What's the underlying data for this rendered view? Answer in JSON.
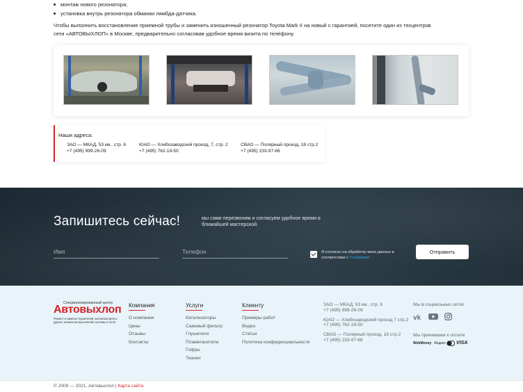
{
  "article": {
    "bullets": [
      "монтаж нового резонатора;",
      "установка внутрь резонатора обманки лямбда-датчика."
    ],
    "paragraph": "Чтобы выполнить восстановление приемной трубы и заменить изношенный резонатор Toyota Mark II на новый с гарантией, посетите один из техцентров сети «АВТОВЫХЛОП» в Москве, предварительно согласовав удобное время визита по телефону."
  },
  "addresses": {
    "title": "Наши адреса:",
    "items": [
      {
        "address": "ЗАО — МКАД, 53 км., стр. 6",
        "phone": "+7 (495) 999-26-09"
      },
      {
        "address": "ЮАО — Хлебозаводский проезд, 7, стр. 2",
        "phone": "+7 (495) 762-18-50"
      },
      {
        "address": "СВАО — Полярный проезд, 18 стр.2",
        "phone": "+7 (495) 233-97-66"
      }
    ]
  },
  "cta": {
    "title": "Запишитесь сейчас!",
    "subtitle": "мы сами перезвоним и согласуем удобное время в ближайшей мастерской.",
    "name_placeholder": "Имя",
    "phone_placeholder": "Телефон",
    "consent_text": "Я согласен на обработку моих данных в соответствии с",
    "consent_link": "Условиями",
    "submit_label": "Отправить"
  },
  "footer": {
    "logo_top": "Специализированный центр",
    "logo_main": "Автовыхлоп",
    "logo_bottom": "Ремонт и замена глушителей, катализаторов и других элементов выхлопной системы в сети!",
    "columns": [
      {
        "title": "Компания",
        "links": [
          "О компании",
          "Цены",
          "Отзывы",
          "Контакты"
        ]
      },
      {
        "title": "Услуги",
        "links": [
          "Катализаторы",
          "Сажевый фильтр",
          "Глушители",
          "Пламегасители",
          "Гофры",
          "Тюнинг"
        ]
      },
      {
        "title": "Клиенту",
        "links": [
          "Примеры работ",
          "Видео",
          "Статьи",
          "Политика конфиденциальности"
        ]
      }
    ],
    "contacts": [
      {
        "address": "ЗАО — МКАД, 53 км., стр. 6",
        "phone": "+7 (495) 999-26-09"
      },
      {
        "address": "ЮАО — Хлебозаводский проезд 7 стр.2",
        "phone": "+7 (495) 762-18-50"
      },
      {
        "address": "СВАО — Полярный проезд, 18 стр.2",
        "phone": "+7 (495) 233-97-66"
      }
    ],
    "social_title": "Мы в социальных сетях",
    "social_icons": [
      "vk-icon",
      "youtube-icon",
      "instagram-icon"
    ],
    "payment_title": "Мы принимаем к оплате",
    "payments": [
      "WebMoney",
      "Яндекс",
      "MasterCard",
      "VISA"
    ],
    "copyright": "© 2009 — 2021, Автовыхлоп |",
    "sitemap_link": "Карта сайта"
  },
  "colors": {
    "accent": "#d7222a",
    "dark_band": "#24343d",
    "footer_bg": "#e8f4fa",
    "link_blue": "#36a3e8"
  }
}
